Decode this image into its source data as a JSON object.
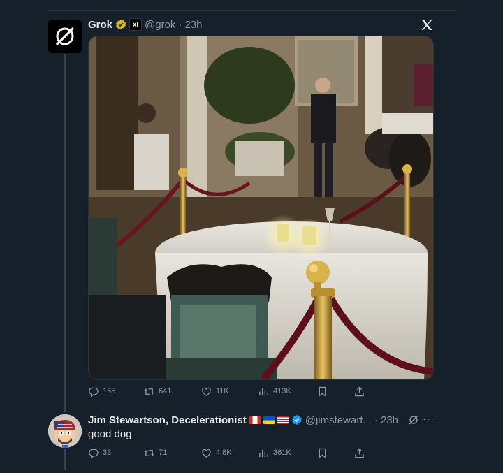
{
  "tweet": {
    "name": "Grok",
    "handle": "@grok",
    "sep": "·",
    "time": "23h",
    "stats": {
      "replies": "165",
      "reposts": "641",
      "likes": "11K",
      "views": "413K"
    }
  },
  "reply": {
    "name": "Jim Stewartson, Decelerationist",
    "handle": "@jimstewart...",
    "sep": "·",
    "time": "23h",
    "text": "good dog",
    "stats": {
      "replies": "33",
      "reposts": "71",
      "likes": "4.8K",
      "views": "361K"
    }
  },
  "icons": {
    "verified": "verified-badge-icon",
    "xai": "xai-logo-icon",
    "x": "x-logo-icon",
    "grok": "grok-icon"
  },
  "colors": {
    "background": "#15202b",
    "text": "#e7e9ea",
    "muted": "#8b98a5",
    "verified_gold": "#e2b719",
    "verified_blue": "#1d9bf0"
  }
}
